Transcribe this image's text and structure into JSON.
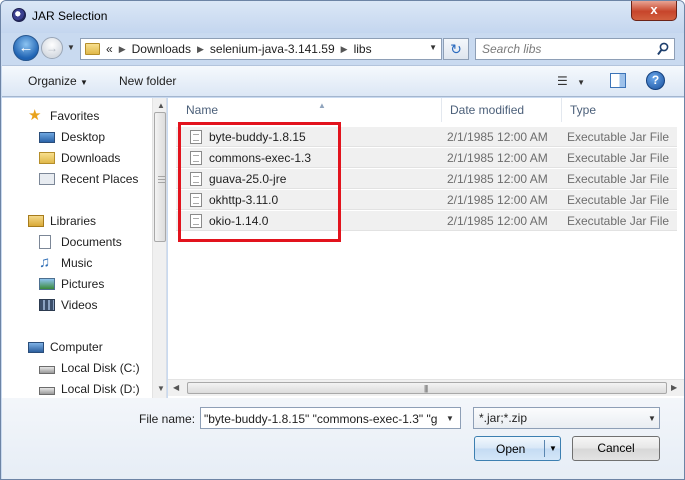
{
  "window": {
    "title": "JAR Selection",
    "close_label": "x"
  },
  "address": {
    "overflow": "«",
    "crumbs": [
      "Downloads",
      "selenium-java-3.141.59",
      "libs"
    ]
  },
  "search": {
    "placeholder": "Search libs"
  },
  "toolbar": {
    "organize": "Organize",
    "new_folder": "New folder"
  },
  "nav": {
    "favorites_label": "Favorites",
    "favorites": [
      "Desktop",
      "Downloads",
      "Recent Places"
    ],
    "libraries_label": "Libraries",
    "libraries": [
      "Documents",
      "Music",
      "Pictures",
      "Videos"
    ],
    "computer_label": "Computer",
    "drives": [
      "Local Disk (C:)",
      "Local Disk (D:)"
    ]
  },
  "columns": {
    "name": "Name",
    "date": "Date modified",
    "type": "Type"
  },
  "files": [
    {
      "name": "byte-buddy-1.8.15",
      "date": "2/1/1985 12:00 AM",
      "type": "Executable Jar File"
    },
    {
      "name": "commons-exec-1.3",
      "date": "2/1/1985 12:00 AM",
      "type": "Executable Jar File"
    },
    {
      "name": "guava-25.0-jre",
      "date": "2/1/1985 12:00 AM",
      "type": "Executable Jar File"
    },
    {
      "name": "okhttp-3.11.0",
      "date": "2/1/1985 12:00 AM",
      "type": "Executable Jar File"
    },
    {
      "name": "okio-1.14.0",
      "date": "2/1/1985 12:00 AM",
      "type": "Executable Jar File"
    }
  ],
  "footer": {
    "file_name_label": "File name:",
    "file_name_value": "\"byte-buddy-1.8.15\" \"commons-exec-1.3\" \"g",
    "filter": "*.jar;*.zip",
    "open": "Open",
    "cancel": "Cancel"
  },
  "colors": {
    "highlight": "#e2131d",
    "accent": "#1f63b3"
  }
}
